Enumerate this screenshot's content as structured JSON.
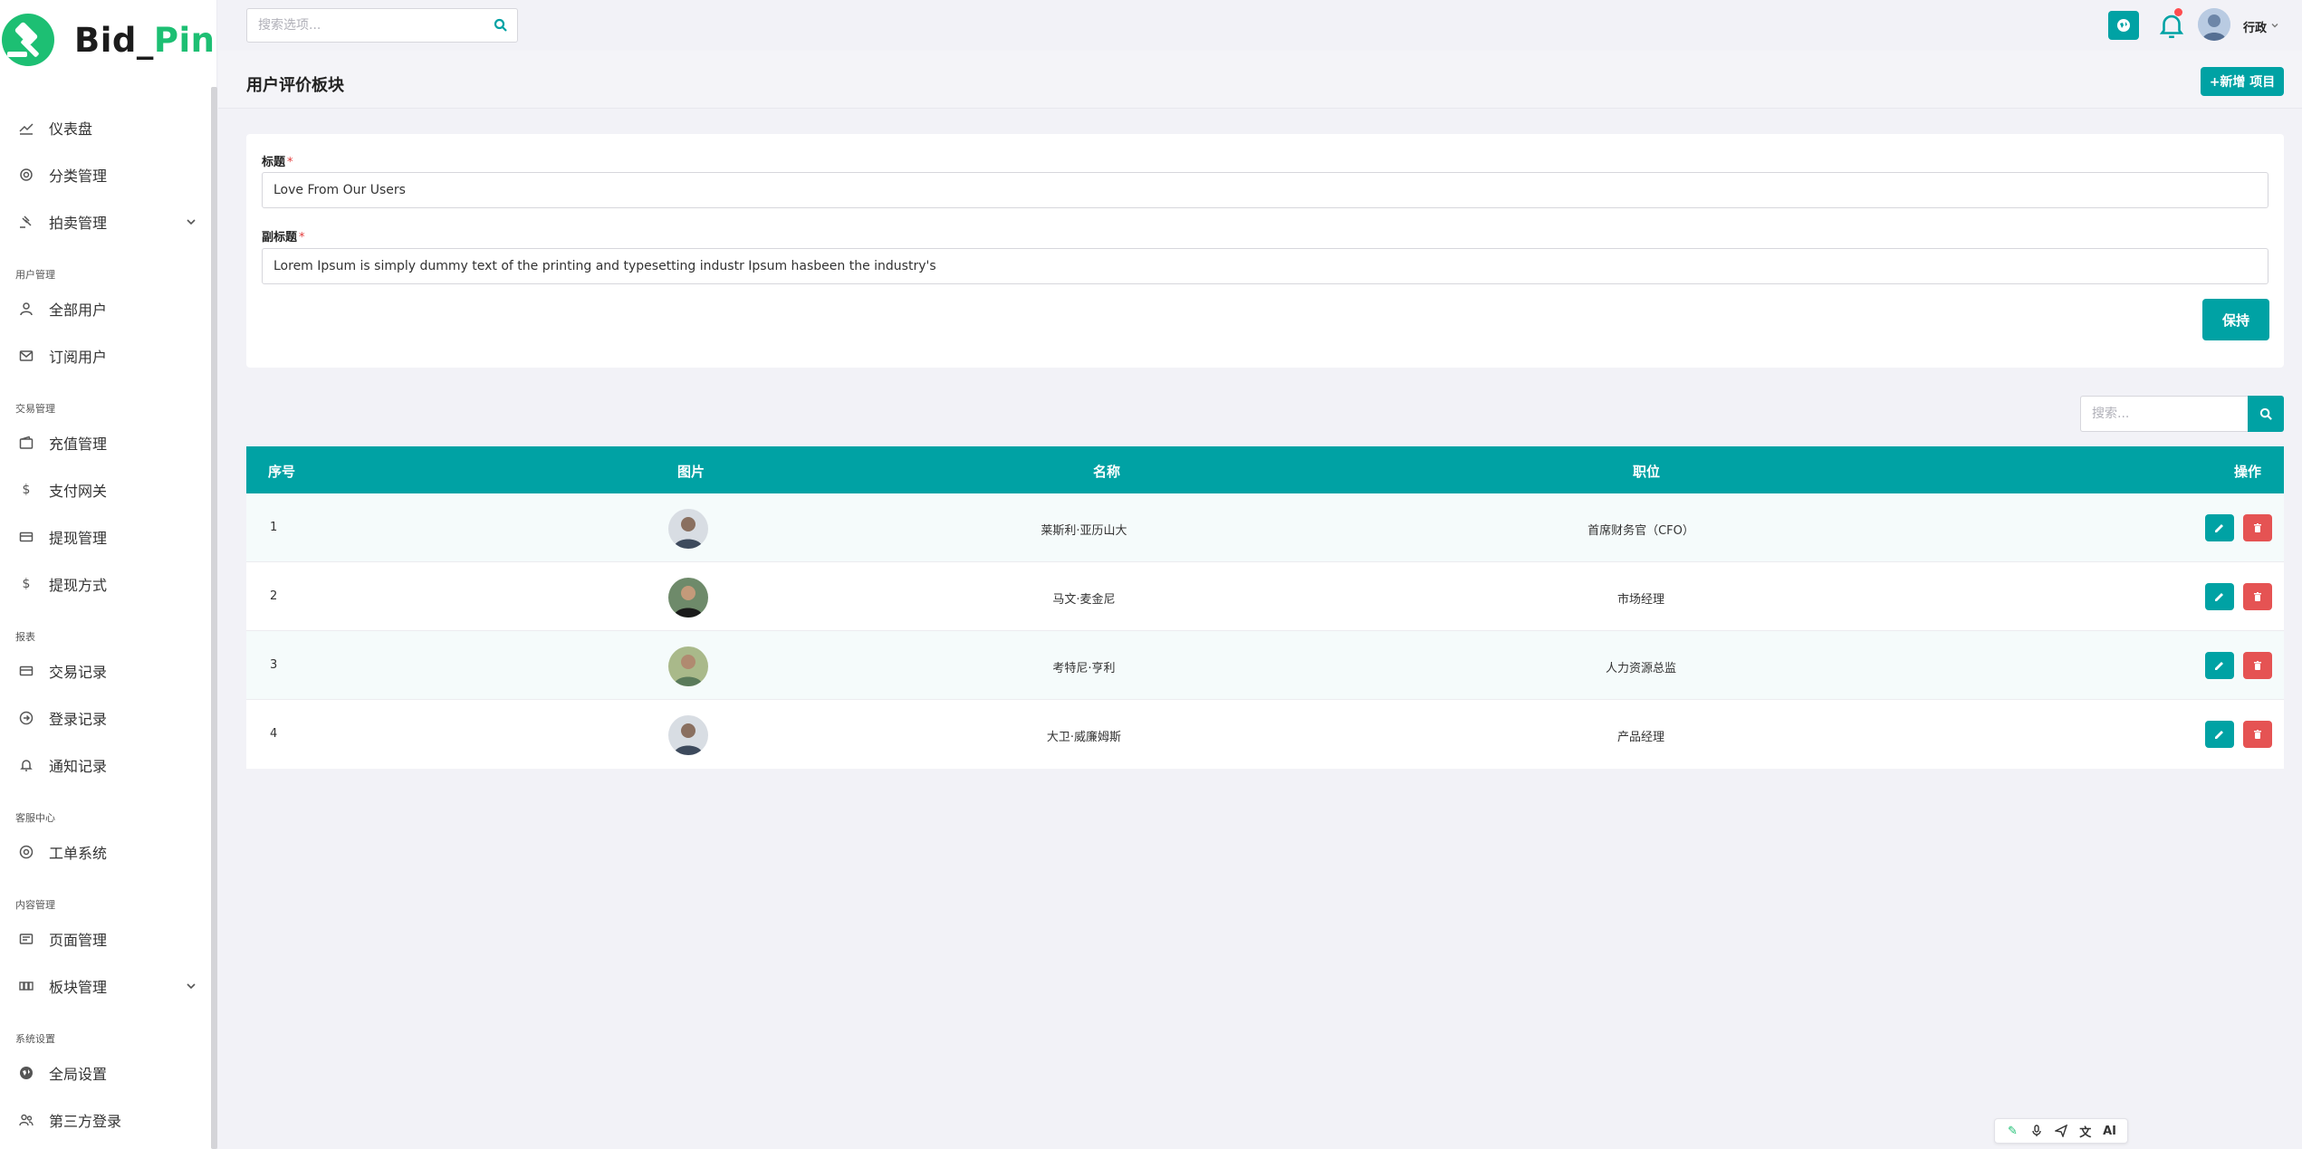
{
  "brand": {
    "part1": "Bid_",
    "part2": "Pin",
    "accent": "#1dbf73",
    "primary": "#00a2a4"
  },
  "topbar": {
    "search_placeholder": "搜索选项...",
    "user_name": "行政",
    "icons": [
      "globe-icon",
      "bell-icon",
      "avatar",
      "chevron-down-icon"
    ]
  },
  "sidebar": {
    "items": [
      {
        "label": "仪表盘",
        "icon": "dashboard-icon"
      },
      {
        "label": "分类管理",
        "icon": "category-icon"
      },
      {
        "label": "拍卖管理",
        "icon": "gavel-icon",
        "expandable": true
      }
    ],
    "sections": [
      {
        "title": "用户管理",
        "items": [
          {
            "label": "全部用户",
            "icon": "user-icon"
          },
          {
            "label": "订阅用户",
            "icon": "mail-icon"
          }
        ]
      },
      {
        "title": "交易管理",
        "items": [
          {
            "label": "充值管理",
            "icon": "wallet-icon"
          },
          {
            "label": "支付网关",
            "icon": "dollar-icon"
          },
          {
            "label": "提现管理",
            "icon": "card-icon"
          },
          {
            "label": "提现方式",
            "icon": "dollar-icon"
          }
        ]
      },
      {
        "title": "报表",
        "items": [
          {
            "label": "交易记录",
            "icon": "card-icon"
          },
          {
            "label": "登录记录",
            "icon": "login-icon"
          },
          {
            "label": "通知记录",
            "icon": "bell-icon"
          }
        ]
      },
      {
        "title": "客服中心",
        "items": [
          {
            "label": "工单系统",
            "icon": "lifebuoy-icon"
          }
        ]
      },
      {
        "title": "内容管理",
        "items": [
          {
            "label": "页面管理",
            "icon": "page-icon"
          },
          {
            "label": "板块管理",
            "icon": "grid-icon",
            "expandable": true
          }
        ]
      },
      {
        "title": "系统设置",
        "items": [
          {
            "label": "全局设置",
            "icon": "globe-icon"
          },
          {
            "label": "第三方登录",
            "icon": "users-icon"
          }
        ]
      }
    ]
  },
  "page": {
    "title": "用户评价板块",
    "add_button": "+新增 项目"
  },
  "form": {
    "title_label": "标题",
    "title_value": "Love From Our Users",
    "subtitle_label": "副标题",
    "subtitle_value": "Lorem Ipsum is simply dummy text of the printing and typesetting industr Ipsum hasbeen the industry's",
    "required_mark": "*",
    "save_button": "保持"
  },
  "table": {
    "search_placeholder": "搜索...",
    "headers": [
      "序号",
      "图片",
      "名称",
      "职位",
      "操作"
    ],
    "rows": [
      {
        "index": "1",
        "name": "莱斯利·亚历山大",
        "position": "首席财务官（CFO）"
      },
      {
        "index": "2",
        "name": "马文·麦金尼",
        "position": "市场经理"
      },
      {
        "index": "3",
        "name": "考特尼·亨利",
        "position": "人力资源总监"
      },
      {
        "index": "4",
        "name": "大卫·威廉姆斯",
        "position": "产品经理"
      }
    ]
  },
  "floating_toolbar": {
    "ai_label": "AI"
  }
}
